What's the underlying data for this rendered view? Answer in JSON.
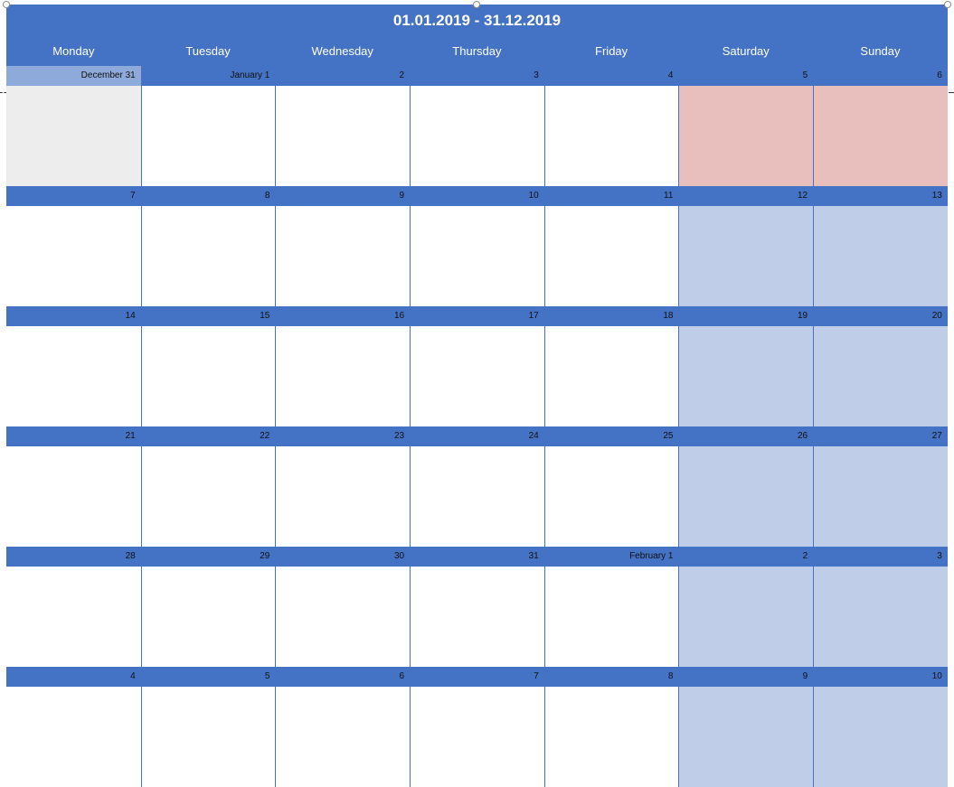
{
  "calendar": {
    "title": "01.01.2019 - 31.12.2019",
    "weekdays": [
      "Monday",
      "Tuesday",
      "Wednesday",
      "Thursday",
      "Friday",
      "Saturday",
      "Sunday"
    ],
    "colors": {
      "header": "#4472c4",
      "weekend_cell": "#bfcde9",
      "holiday_cell": "#e8bfbc",
      "prev_month_cell": "#ededed",
      "prev_month_bar": "#8eaadb"
    },
    "weeks": [
      [
        {
          "label": "December 31",
          "type": "prev-month"
        },
        {
          "label": "January 1",
          "type": "normal"
        },
        {
          "label": "2",
          "type": "normal"
        },
        {
          "label": "3",
          "type": "normal"
        },
        {
          "label": "4",
          "type": "normal"
        },
        {
          "label": "5",
          "type": "holiday"
        },
        {
          "label": "6",
          "type": "holiday"
        }
      ],
      [
        {
          "label": "7",
          "type": "normal"
        },
        {
          "label": "8",
          "type": "normal"
        },
        {
          "label": "9",
          "type": "normal"
        },
        {
          "label": "10",
          "type": "normal"
        },
        {
          "label": "11",
          "type": "normal"
        },
        {
          "label": "12",
          "type": "weekend"
        },
        {
          "label": "13",
          "type": "weekend"
        }
      ],
      [
        {
          "label": "14",
          "type": "normal"
        },
        {
          "label": "15",
          "type": "normal"
        },
        {
          "label": "16",
          "type": "normal"
        },
        {
          "label": "17",
          "type": "normal"
        },
        {
          "label": "18",
          "type": "normal"
        },
        {
          "label": "19",
          "type": "weekend"
        },
        {
          "label": "20",
          "type": "weekend"
        }
      ],
      [
        {
          "label": "21",
          "type": "normal"
        },
        {
          "label": "22",
          "type": "normal"
        },
        {
          "label": "23",
          "type": "normal"
        },
        {
          "label": "24",
          "type": "normal"
        },
        {
          "label": "25",
          "type": "normal"
        },
        {
          "label": "26",
          "type": "weekend"
        },
        {
          "label": "27",
          "type": "weekend"
        }
      ],
      [
        {
          "label": "28",
          "type": "normal"
        },
        {
          "label": "29",
          "type": "normal"
        },
        {
          "label": "30",
          "type": "normal"
        },
        {
          "label": "31",
          "type": "normal"
        },
        {
          "label": "February 1",
          "type": "normal"
        },
        {
          "label": "2",
          "type": "weekend"
        },
        {
          "label": "3",
          "type": "weekend"
        }
      ],
      [
        {
          "label": "4",
          "type": "normal"
        },
        {
          "label": "5",
          "type": "normal"
        },
        {
          "label": "6",
          "type": "normal"
        },
        {
          "label": "7",
          "type": "normal"
        },
        {
          "label": "8",
          "type": "normal"
        },
        {
          "label": "9",
          "type": "weekend"
        },
        {
          "label": "10",
          "type": "weekend"
        }
      ]
    ]
  }
}
